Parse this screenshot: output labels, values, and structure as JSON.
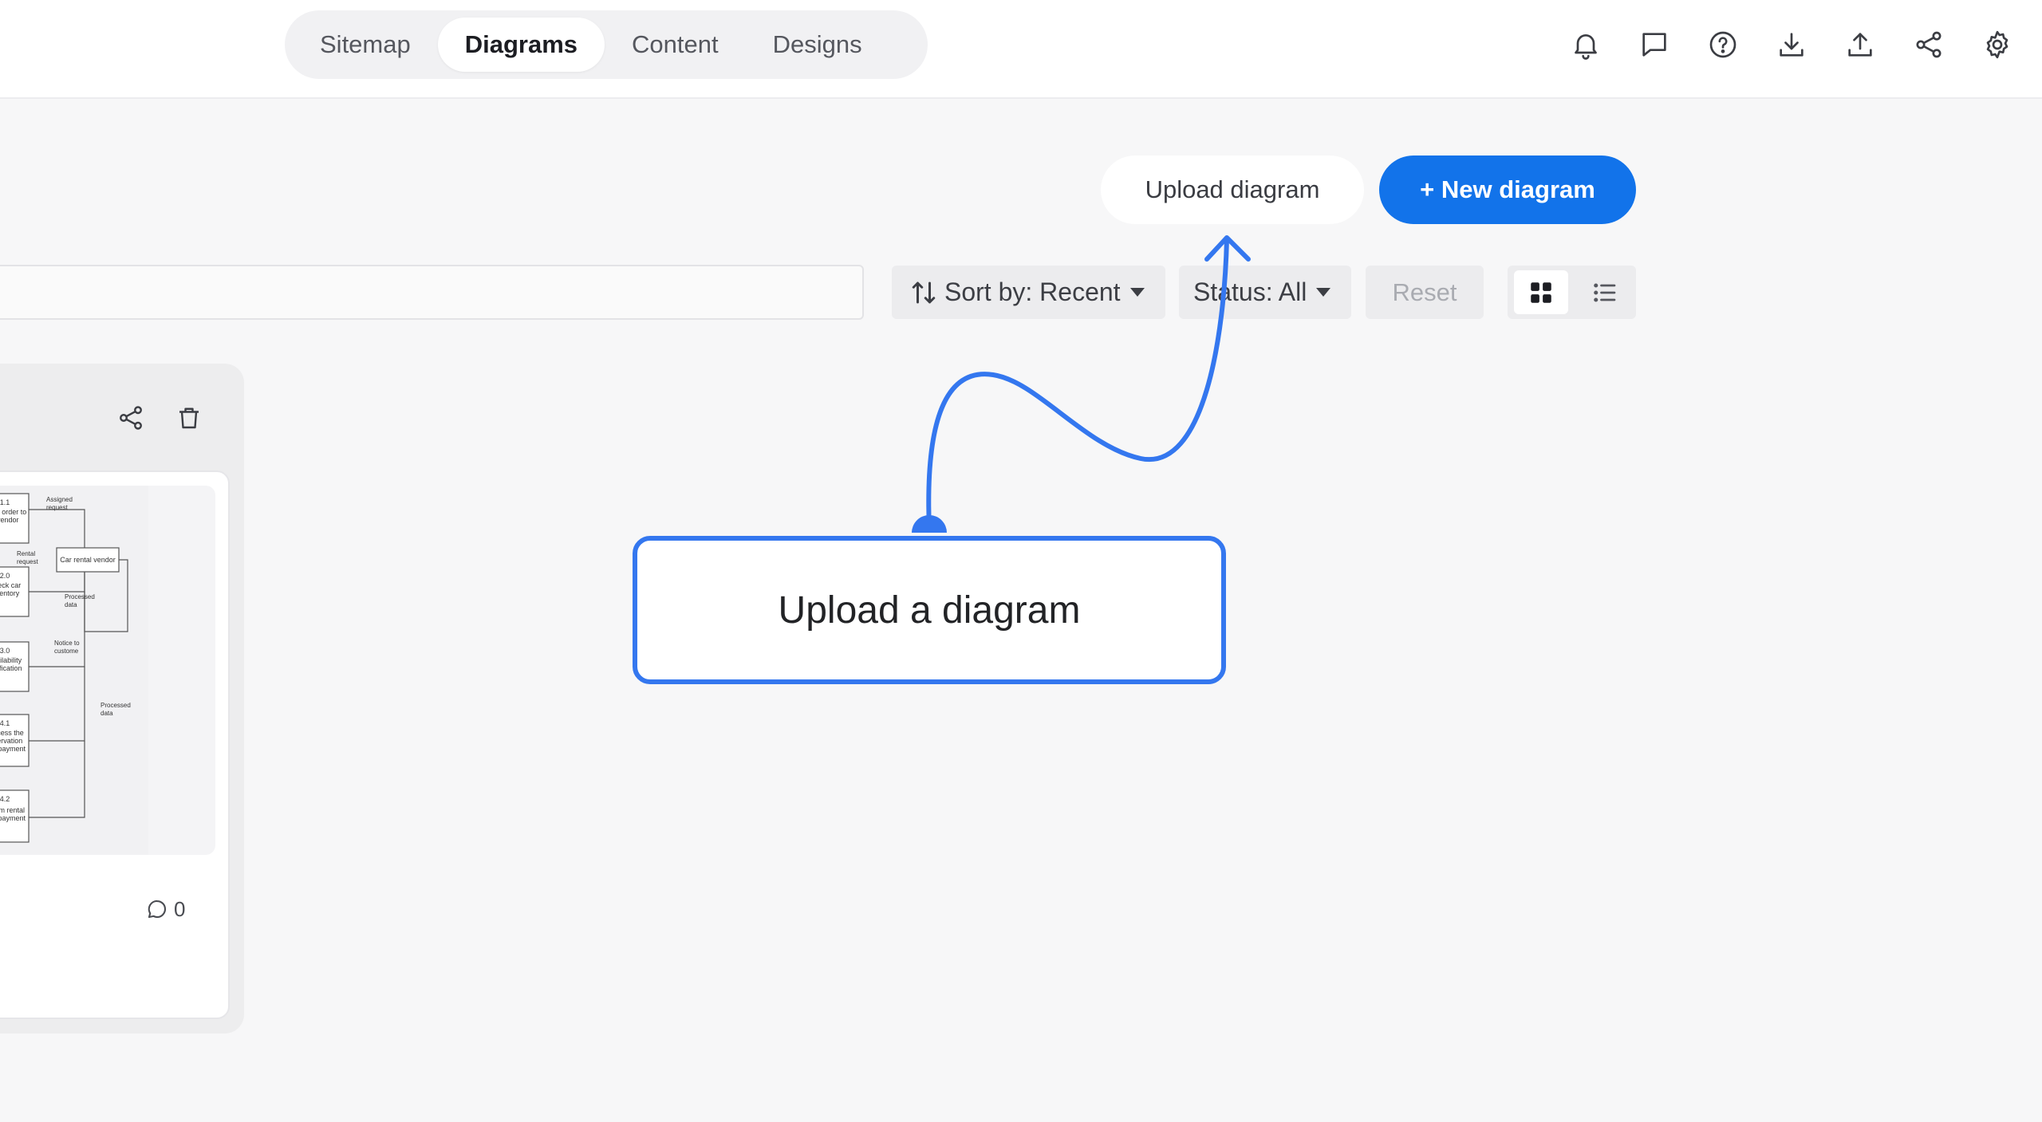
{
  "tabs": [
    {
      "label": "Sitemap",
      "active": false
    },
    {
      "label": "Diagrams",
      "active": true
    },
    {
      "label": "Content",
      "active": false
    },
    {
      "label": "Designs",
      "active": false
    }
  ],
  "top_icons": [
    "bell-icon",
    "message-icon",
    "help-icon",
    "download-icon",
    "upload-icon",
    "share-icon",
    "settings-icon"
  ],
  "actions": {
    "upload_label": "Upload diagram",
    "new_label": "+ New diagram"
  },
  "filters": {
    "search_placeholder": "",
    "sort_label": "Sort by: Recent",
    "status_label": "Status: All",
    "reset_label": "Reset",
    "view_mode": "grid"
  },
  "card": {
    "comment_count": "0",
    "thumbnail": {
      "boxes": [
        {
          "id": "1.1",
          "lines": [
            "1.1",
            "ssign order to",
            "a vendor"
          ]
        },
        {
          "id": "2.0",
          "lines": [
            "2.0",
            "Check car",
            "inventory"
          ]
        },
        {
          "id": "3.0",
          "lines": [
            "3.0",
            "Availability",
            "notification"
          ]
        },
        {
          "id": "4.1",
          "lines": [
            "4.1",
            "Process the",
            "reservation",
            "and payment"
          ]
        },
        {
          "id": "4.2",
          "lines": [
            "4.2",
            "onfirm rental",
            "and payment"
          ]
        }
      ],
      "entity": "Car rental vendor",
      "flow_labels": [
        "Assigned",
        "request",
        "Rental",
        "request",
        "Processed",
        "data",
        "Notice to",
        "custome",
        "Processed",
        "data"
      ]
    }
  },
  "annotation": {
    "callout_text": "Upload a diagram"
  },
  "colors": {
    "accent": "#1273ea",
    "annotation": "#3477ef"
  }
}
